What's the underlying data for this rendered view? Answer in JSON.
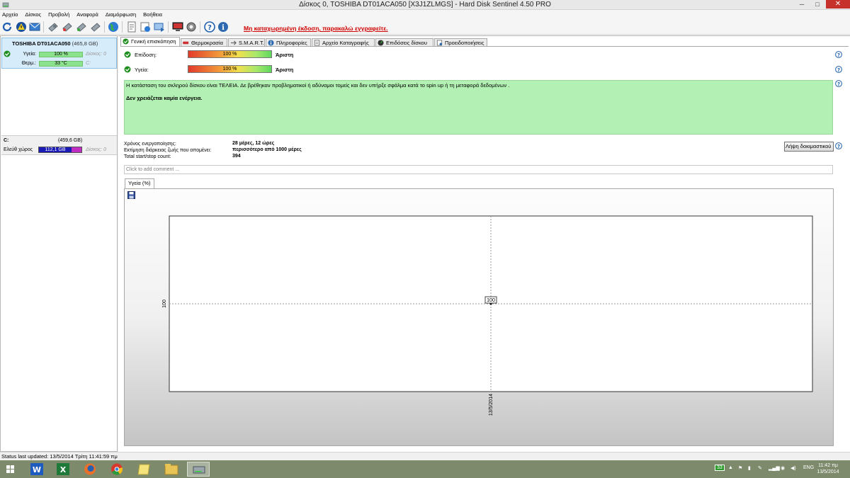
{
  "window": {
    "title": "Δίσκος 0, TOSHIBA DT01ACA050 [X3J1ZLMGS]  -  Hard Disk Sentinel 4.50 PRO",
    "minimize": "─",
    "maximize": "□",
    "close": "✕"
  },
  "menu": [
    "Αρχείο",
    "Δίσκος",
    "Προβολή",
    "Αναφορά",
    "Διαμόρφωση",
    "Βοήθεια"
  ],
  "toolbar": {
    "unregistered_text": "Μη καταχωρημένη έκδοση, παρακαλώ εγγραφείτε."
  },
  "disk": {
    "name": "TOSHIBA DT01ACA050",
    "size": "(465,8 GB)",
    "health_label": "Υγεία:",
    "health_value": "100 %",
    "health_percent": 100,
    "temp_label": "Θερμ.:",
    "temp_value": "33 °C",
    "disk_index": "Δίσκος: 0",
    "drive_letter": "C:"
  },
  "volume": {
    "name": "C:",
    "size": "(459,6 GB)",
    "free_label": "Ελεύθ χώρος",
    "free_value": "112,1 GB",
    "disk_index": "Δίσκος: 0"
  },
  "tabs": [
    {
      "label": "Γενική επισκόπηση",
      "active": true
    },
    {
      "label": "Θερμοκρασία"
    },
    {
      "label": "S.M.A.R.T."
    },
    {
      "label": "Πληροφορίες"
    },
    {
      "label": "Αρχείο Καταγραφής"
    },
    {
      "label": "Επιδόσεις δίσκου"
    },
    {
      "label": "Προειδοποιήσεις"
    }
  ],
  "overview": {
    "performance_label": "Επίδοση:",
    "performance_value": "100 %",
    "performance_percent": 100,
    "performance_rating": "Άριστη",
    "health_label": "Υγεία:",
    "health_value": "100 %",
    "health_percent": 100,
    "health_rating": "Άριστη",
    "status_text": "Η κατάσταση του σκληρού δίσκου είναι ΤΕΛΕΙΑ. Δε βρέθηκαν προβληματικοί ή αδύναμοι τομείς και δεν υπήρξε σφάλμα κατά το spin up ή τη μεταφορά δεδομένων .",
    "action_text": "Δεν χρειάζεται καμία ενέργεια.",
    "power_on_label": "Χρόνος ενεργοποίησης:",
    "power_on_value": "28 μέρες, 12 ώρες",
    "lifetime_label": "Εκτίμηση διάρκειας ζωής που απομένει:",
    "lifetime_value": "περισσότερο από 1000 μέρες",
    "startstop_label": "Total start/stop count:",
    "startstop_value": "394",
    "download_button": "Λήψη δοκιμαστικού",
    "comment_placeholder": "Click to add comment ..."
  },
  "graph_tab": "Υγεία (%)",
  "chart_data": {
    "type": "line",
    "x": [
      "13/5/2014"
    ],
    "series": [
      {
        "values": [
          100
        ]
      }
    ],
    "tick_labels_y": [
      "100"
    ],
    "data_labels": [
      "100"
    ],
    "grid": true
  },
  "statusbar": "Status last updated: 13/5/2014 Τρίτη 11:41:59 πμ",
  "taskbar": {
    "tray_number": "33",
    "language": "ENG",
    "time": "11:42 πμ",
    "date": "13/5/2014"
  }
}
